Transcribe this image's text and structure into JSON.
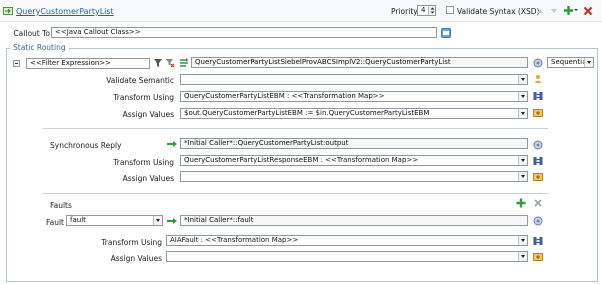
{
  "header": {
    "title": "QueryCustomerPartyList",
    "priority_label": "Priority",
    "priority_value": "4",
    "validate_syntax_label": "Validate Syntax (XSD)"
  },
  "callout": {
    "label": "Callout To",
    "value": "<<Java Callout Class>>"
  },
  "static_routing": {
    "legend": "Static Routing",
    "filter_expression": "<<Filter Expression>>",
    "target_service": "QueryCustomerPartyListSiebelProvABCSImplV2::QueryCustomerPartyList",
    "mode": "Sequential",
    "validate_semantic_label": "Validate Semantic",
    "transform_label": "Transform Using",
    "transform_value": "QueryCustomerPartyListEBM : <<Transformation Map>>",
    "assign_label": "Assign Values",
    "assign_value": "$out.QueryCustomerPartyListEBM := $in.QueryCustomerPartyListEBM"
  },
  "sync_reply": {
    "label": "Synchronous Reply",
    "target": "*Initial Caller*::QueryCustomerPartyList:output",
    "transform_label": "Transform Using",
    "transform_value": "QueryCustomerPartyListResponseEBM : <<Transformation Map>>",
    "assign_label": "Assign Values",
    "assign_value": ""
  },
  "faults": {
    "title": "Faults",
    "fault_label": "Fault",
    "fault_value": "fault",
    "target": "*Initial Caller*::fault",
    "transform_label": "Transform Using",
    "transform_value": "AIAFault : <<Transformation Map>>",
    "assign_label": "Assign Values",
    "assign_value": ""
  },
  "colors": {
    "accent_green": "#2f9b3a",
    "delete_red": "#c9302c",
    "link_blue": "#2a5db0",
    "panel_border": "#b7c6d6"
  }
}
